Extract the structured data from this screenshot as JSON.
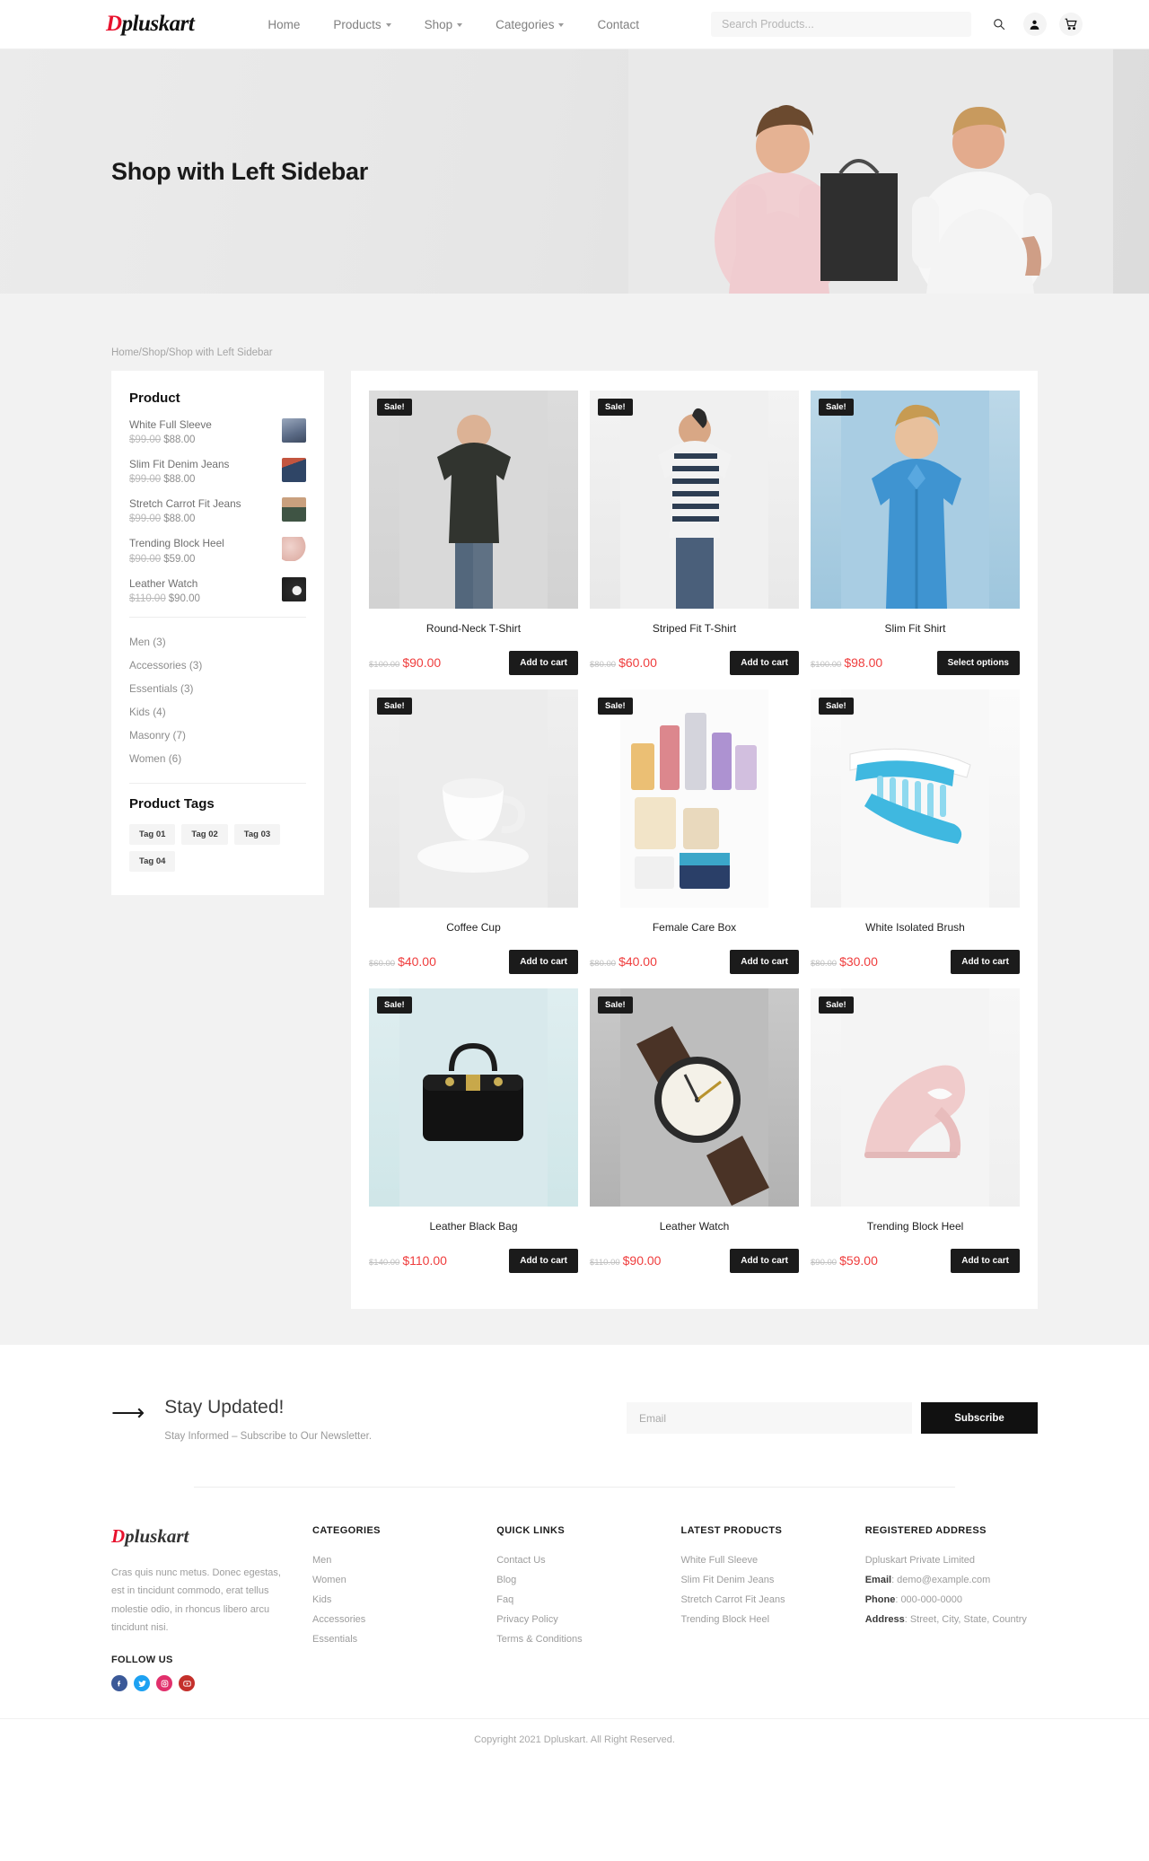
{
  "header": {
    "logo_d": "D",
    "logo_rest": "pluskart",
    "nav": [
      {
        "label": "Home",
        "has_caret": false
      },
      {
        "label": "Products",
        "has_caret": true
      },
      {
        "label": "Shop",
        "has_caret": true
      },
      {
        "label": "Categories",
        "has_caret": true
      },
      {
        "label": "Contact",
        "has_caret": false
      }
    ],
    "search_placeholder": "Search Products...",
    "icons": [
      "search-icon",
      "account-icon",
      "cart-icon"
    ]
  },
  "hero": {
    "title": "Shop with Left Sidebar"
  },
  "breadcrumb": "Home/Shop/Shop with Left Sidebar",
  "sidebar": {
    "product_widget_title": "Product",
    "products": [
      {
        "name": "White Full Sleeve",
        "old": "$99.00",
        "new": "$88.00",
        "thumb": "#6d7f9c"
      },
      {
        "name": "Slim Fit Denim Jeans",
        "old": "$99.00",
        "new": "$88.00",
        "thumb": "#3c4a63"
      },
      {
        "name": "Stretch Carrot Fit Jeans",
        "old": "$99.00",
        "new": "$88.00",
        "thumb": "#4b5e52"
      },
      {
        "name": "Trending Block Heel",
        "old": "$90.00",
        "new": "$59.00",
        "thumb": "#e8c9c3"
      },
      {
        "name": "Leather Watch",
        "old": "$110.00",
        "new": "$90.00",
        "thumb": "#2b2b2b"
      }
    ],
    "categories": [
      "Men (3)",
      "Accessories (3)",
      "Essentials (3)",
      "Kids (4)",
      "Masonry (7)",
      "Women (6)"
    ],
    "tags_title": "Product Tags",
    "tags": [
      "Tag 01",
      "Tag 02",
      "Tag 03",
      "Tag 04"
    ]
  },
  "products": [
    {
      "badge": "Sale!",
      "title": "Round-Neck T-Shirt",
      "old": "$100.00",
      "new": "$90.00",
      "button": "Add to cart",
      "img": "tshirt-black"
    },
    {
      "badge": "Sale!",
      "title": "Striped Fit T-Shirt",
      "old": "$80.00",
      "new": "$60.00",
      "button": "Add to cart",
      "img": "tshirt-striped"
    },
    {
      "badge": "Sale!",
      "title": "Slim Fit Shirt",
      "old": "$100.00",
      "new": "$98.00",
      "button": "Select options",
      "img": "shirt-blue"
    },
    {
      "badge": "Sale!",
      "title": "Coffee Cup",
      "old": "$60.00",
      "new": "$40.00",
      "button": "Add to cart",
      "img": "coffee-cup"
    },
    {
      "badge": "Sale!",
      "title": "Female Care Box",
      "old": "$80.00",
      "new": "$40.00",
      "button": "Add to cart",
      "img": "care-box"
    },
    {
      "badge": "Sale!",
      "title": "White Isolated Brush",
      "old": "$80.00",
      "new": "$30.00",
      "button": "Add to cart",
      "img": "toothbrush"
    },
    {
      "badge": "Sale!",
      "title": "Leather Black Bag",
      "old": "$140.00",
      "new": "$110.00",
      "button": "Add to cart",
      "img": "black-bag"
    },
    {
      "badge": "Sale!",
      "title": "Leather Watch",
      "old": "$110.00",
      "new": "$90.00",
      "button": "Add to cart",
      "img": "watch"
    },
    {
      "badge": "Sale!",
      "title": "Trending Block Heel",
      "old": "$90.00",
      "new": "$59.00",
      "button": "Add to cart",
      "img": "heel"
    }
  ],
  "newsletter": {
    "title": "Stay Updated!",
    "subtitle": "Stay Informed – Subscribe to Our Newsletter.",
    "email_placeholder": "Email",
    "button": "Subscribe"
  },
  "footer": {
    "logo_d": "D",
    "logo_rest": "pluskart",
    "description": "Cras quis nunc metus. Donec egestas, est in tincidunt commodo, erat tellus molestie odio, in rhoncus libero arcu tincidunt nisi.",
    "follow_title": "FOLLOW US",
    "socials": [
      {
        "name": "facebook",
        "glyph": "f",
        "color": "#3b5998"
      },
      {
        "name": "twitter",
        "glyph": "t",
        "color": "#1da1f2"
      },
      {
        "name": "instagram",
        "glyph": "◉",
        "color": "#e1306c"
      },
      {
        "name": "youtube",
        "glyph": "▶",
        "color": "#c4302b"
      }
    ],
    "categories_head": "CATEGORIES",
    "categories": [
      "Men",
      "Women",
      "Kids",
      "Accessories",
      "Essentials"
    ],
    "quick_head": "QUICK LINKS",
    "quick": [
      "Contact Us",
      "Blog",
      "Faq",
      "Privacy Policy",
      "Terms & Conditions"
    ],
    "latest_head": "LATEST PRODUCTS",
    "latest": [
      "White Full Sleeve",
      "Slim Fit Denim Jeans",
      "Stretch Carrot Fit Jeans",
      "Trending Block Heel"
    ],
    "address_head": "REGISTERED ADDRESS",
    "company": "Dpluskart Private Limited",
    "email_label": "Email",
    "email_value": ": demo@example.com",
    "phone_label": "Phone",
    "phone_value": ": 000-000-0000",
    "address_label": "Address",
    "address_value": ": Street, City, State, Country"
  },
  "copyright": "Copyright 2021 Dpluskart. All Right Reserved."
}
